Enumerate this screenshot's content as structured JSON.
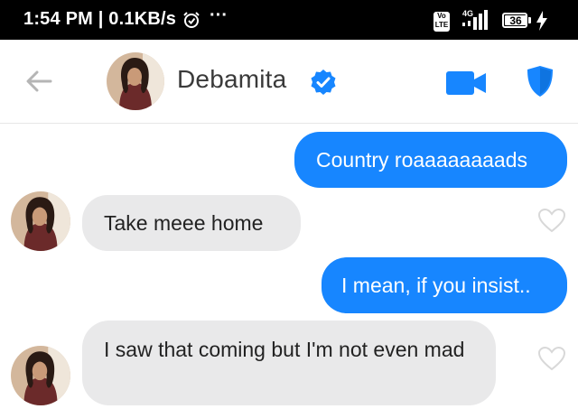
{
  "status_bar": {
    "time": "1:54 PM | 0.1KB/s",
    "more": "···",
    "volte": "Vo LTE",
    "network": "4G",
    "battery": "36"
  },
  "header": {
    "contact_name": "Debamita",
    "verified": true,
    "icons": [
      "back-arrow-icon",
      "avatar",
      "verified-badge-icon",
      "video-call-icon",
      "shield-icon"
    ],
    "accent_color": "#1786ff"
  },
  "messages": [
    {
      "direction": "sent",
      "text": "Country roaaaaaaaads"
    },
    {
      "direction": "received",
      "text": "Take meee home",
      "liked": false
    },
    {
      "direction": "sent",
      "text": "I mean, if you insist.."
    },
    {
      "direction": "received",
      "text": "I saw that coming but I'm not even mad",
      "liked": false
    }
  ],
  "colors": {
    "sent_bubble": "#1786ff",
    "received_bubble": "#e9e9ea"
  }
}
